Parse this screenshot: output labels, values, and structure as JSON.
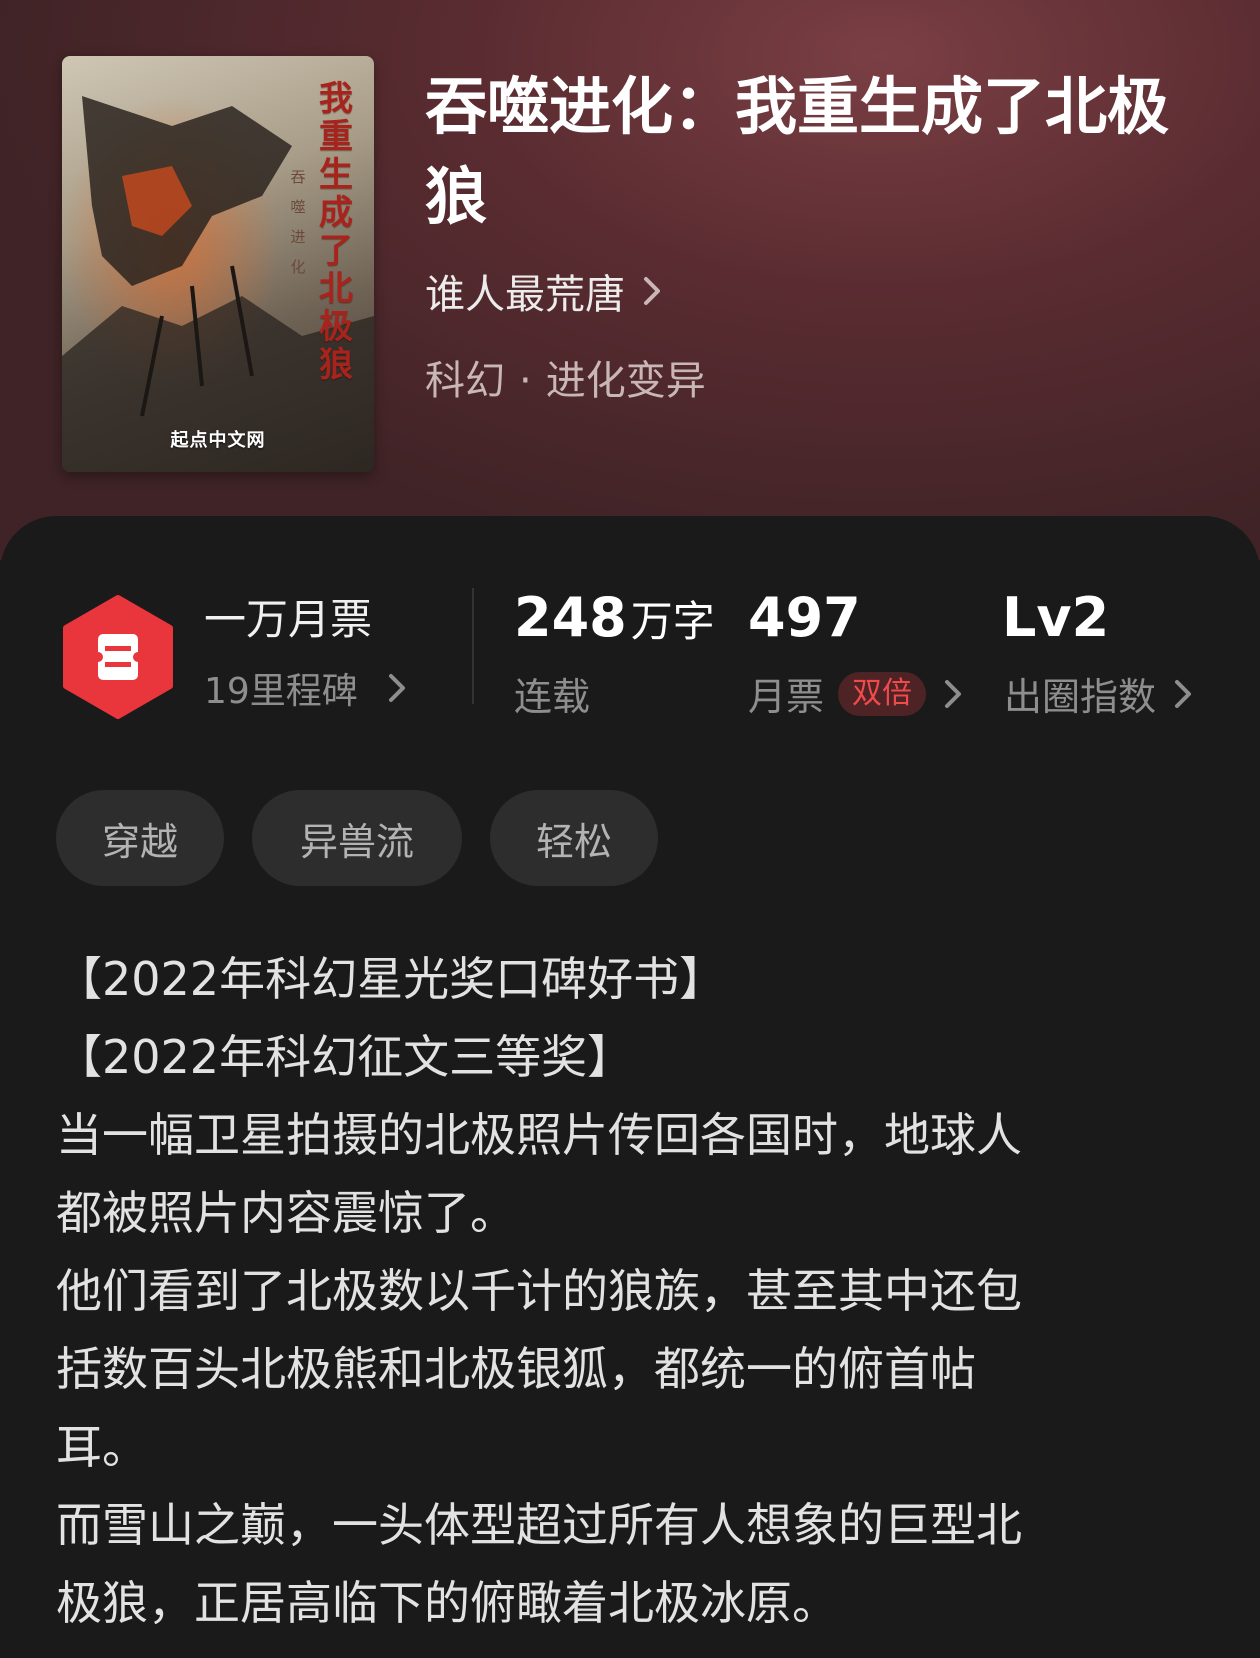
{
  "book": {
    "title": "吞噬进化：我重生成了北极狼",
    "author": "谁人最荒唐",
    "genre": "科幻",
    "subgenre": "进化变异",
    "genre_separator": "·"
  },
  "cover": {
    "title_vertical": "我重生成了北极狼",
    "subtitle_vertical": "吞噬进化",
    "publisher": "起点中文网"
  },
  "honor": {
    "title": "一万月票",
    "subtitle": "19里程碑"
  },
  "stats": {
    "word_count": "248",
    "word_count_unit": "万字",
    "status": "连载",
    "monthly_votes": "497",
    "monthly_votes_label": "月票",
    "double_badge": "双倍",
    "level": "Lv2",
    "level_label": "出圈指数"
  },
  "tags": [
    "穿越",
    "异兽流",
    "轻松"
  ],
  "description": [
    "【2022年科幻星光奖口碑好书】",
    "【2022年科幻征文三等奖】",
    "当一幅卫星拍摄的北极照片传回各国时，地球人",
    "都被照片内容震惊了。",
    "他们看到了北极数以千计的狼族，甚至其中还包",
    "括数百头北极熊和北极银狐，都统一的俯首帖",
    "耳。",
    "而雪山之巅，一头体型超过所有人想象的巨型北",
    "极狼，正居高临下的俯瞰着北极冰原。"
  ],
  "colors": {
    "hero_bg": "#5a2c31",
    "panel_bg": "#1a1a1a",
    "accent_red": "#f04a4a",
    "badge_red": "#e8363c"
  }
}
